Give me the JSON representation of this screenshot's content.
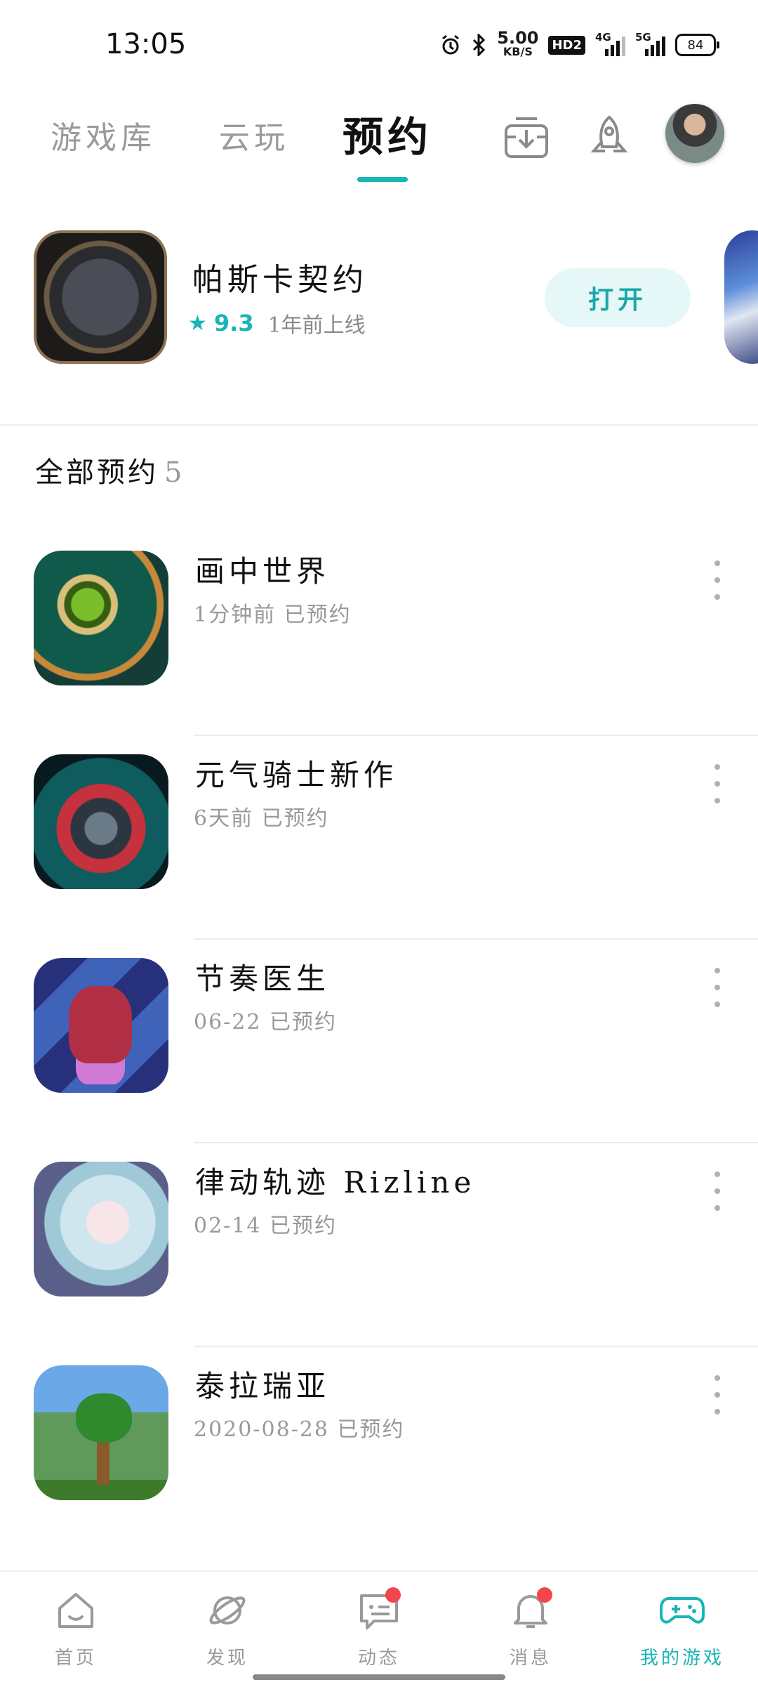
{
  "status_bar": {
    "time": "13:05",
    "speed_value": "5.00",
    "speed_unit": "KB/S",
    "hd_label": "HD2",
    "net1": "4G",
    "net2": "5G",
    "battery": "84",
    "icons": [
      "alarm-icon",
      "bluetooth-icon",
      "hd-icon",
      "signal-4g-icon",
      "signal-5g-icon",
      "battery-icon"
    ]
  },
  "top_tabs": {
    "library": "游戏库",
    "cloud": "云玩",
    "reserve": "预约",
    "active": "reserve",
    "accent": "#19b5b5"
  },
  "featured": {
    "title": "帕斯卡契约",
    "rating": "9.3",
    "time": "1年前上线",
    "open_label": "打开"
  },
  "section": {
    "title": "全部预约",
    "count": "5"
  },
  "reservations": [
    {
      "title": "画中世界",
      "sub": "1分钟前 已预约"
    },
    {
      "title": "元气骑士新作",
      "sub": "6天前 已预约"
    },
    {
      "title": "节奏医生",
      "sub": "06-22 已预约"
    },
    {
      "title": "律动轨迹 Rizline",
      "sub": "02-14 已预约"
    },
    {
      "title": "泰拉瑞亚",
      "sub": "2020-08-28 已预约"
    }
  ],
  "bottom_nav": {
    "home": "首页",
    "discover": "发现",
    "feed": "动态",
    "messages": "消息",
    "my_games": "我的游戏",
    "active": "my_games",
    "badge_color": "#f2454c"
  }
}
